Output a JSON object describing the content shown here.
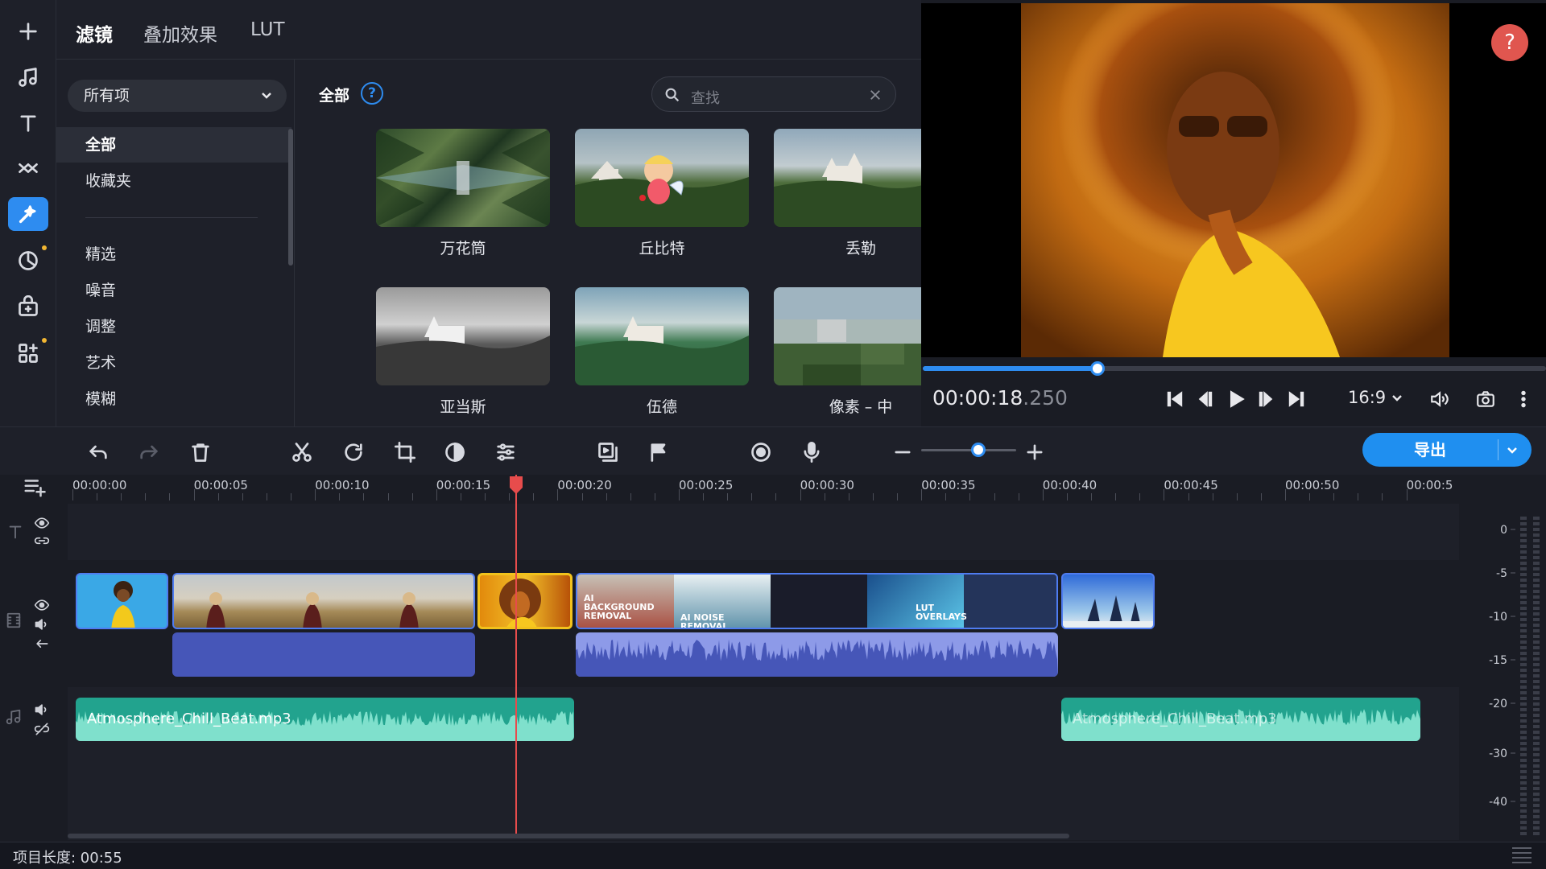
{
  "toolbar": {
    "tools": [
      {
        "name": "add-icon",
        "active": false
      },
      {
        "name": "music-icon",
        "active": false
      },
      {
        "name": "titles-icon",
        "active": false
      },
      {
        "name": "transitions-icon",
        "active": false
      },
      {
        "name": "filters-icon",
        "active": true
      },
      {
        "name": "stickers-icon",
        "active": false
      },
      {
        "name": "store-icon",
        "active": false
      },
      {
        "name": "more-tools-icon",
        "active": false
      }
    ]
  },
  "panel": {
    "tabs": [
      "滤镜",
      "叠加效果",
      "LUT"
    ],
    "dropdown": "所有项",
    "categories": [
      "全部",
      "收藏夹",
      "精选",
      "噪音",
      "调整",
      "艺术",
      "模糊"
    ],
    "grid_title": "全部",
    "search_placeholder": "查找",
    "filters": [
      "万花筒",
      "丘比特",
      "丢勒",
      "亚当斯",
      "伍德",
      "像素 – 中"
    ]
  },
  "preview": {
    "help": "?",
    "timecode_main": "00:00:18",
    "timecode_ms": ".250",
    "aspect_ratio": "16:9",
    "progress": 0.28
  },
  "timeline": {
    "export_label": "导出",
    "ruler_ticks": [
      "00:00:00",
      "00:00:05",
      "00:00:10",
      "00:00:15",
      "00:00:20",
      "00:00:25",
      "00:00:30",
      "00:00:35",
      "00:00:40",
      "00:00:45",
      "00:00:50",
      "00:00:5"
    ],
    "video_clip_labels": [
      "AI BACKGROUND REMOVAL",
      "AI NOISE REMOVAL",
      "LUT OVERLAYS"
    ],
    "audio_clips": [
      "Atmosphere_Chill_Beat.mp3",
      "Atmosphere_Chill_Beat.mp3"
    ],
    "meter_labels": [
      "0",
      "-5",
      "-10",
      "-15",
      "-20",
      "-30",
      "-40"
    ],
    "project_length": "项目长度: 00:55"
  },
  "colors": {
    "accent": "#2e8cf0",
    "playhead": "#e74c4c",
    "audio_clip": "#22a38e",
    "help_button": "#e0564f"
  }
}
